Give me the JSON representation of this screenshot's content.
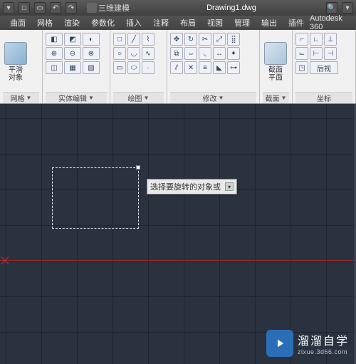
{
  "titlebar": {
    "filename": "Drawing1.dwg",
    "workspace_label": "三维建模"
  },
  "menu": {
    "tabs": [
      "曲面",
      "网格",
      "渲染",
      "参数化",
      "插入",
      "注释",
      "布局",
      "视图",
      "管理",
      "输出",
      "插件"
    ],
    "brand": "Autodesk 360"
  },
  "ribbon": {
    "panel1": {
      "title": "网格",
      "big_label": "平滑\n对象"
    },
    "panel2": {
      "title": "实体编辑"
    },
    "panel3": {
      "title": "绘图"
    },
    "panel4": {
      "title": "修改"
    },
    "panel5": {
      "title": "截面",
      "big_label": "截面\n平面"
    },
    "panel6": {
      "title": "坐标",
      "btn_label": "后视"
    }
  },
  "tooltip": {
    "text": "选择要旋转的对象或"
  },
  "watermark": {
    "title": "溜溜自学",
    "sub": "zixue.3d66.com"
  }
}
